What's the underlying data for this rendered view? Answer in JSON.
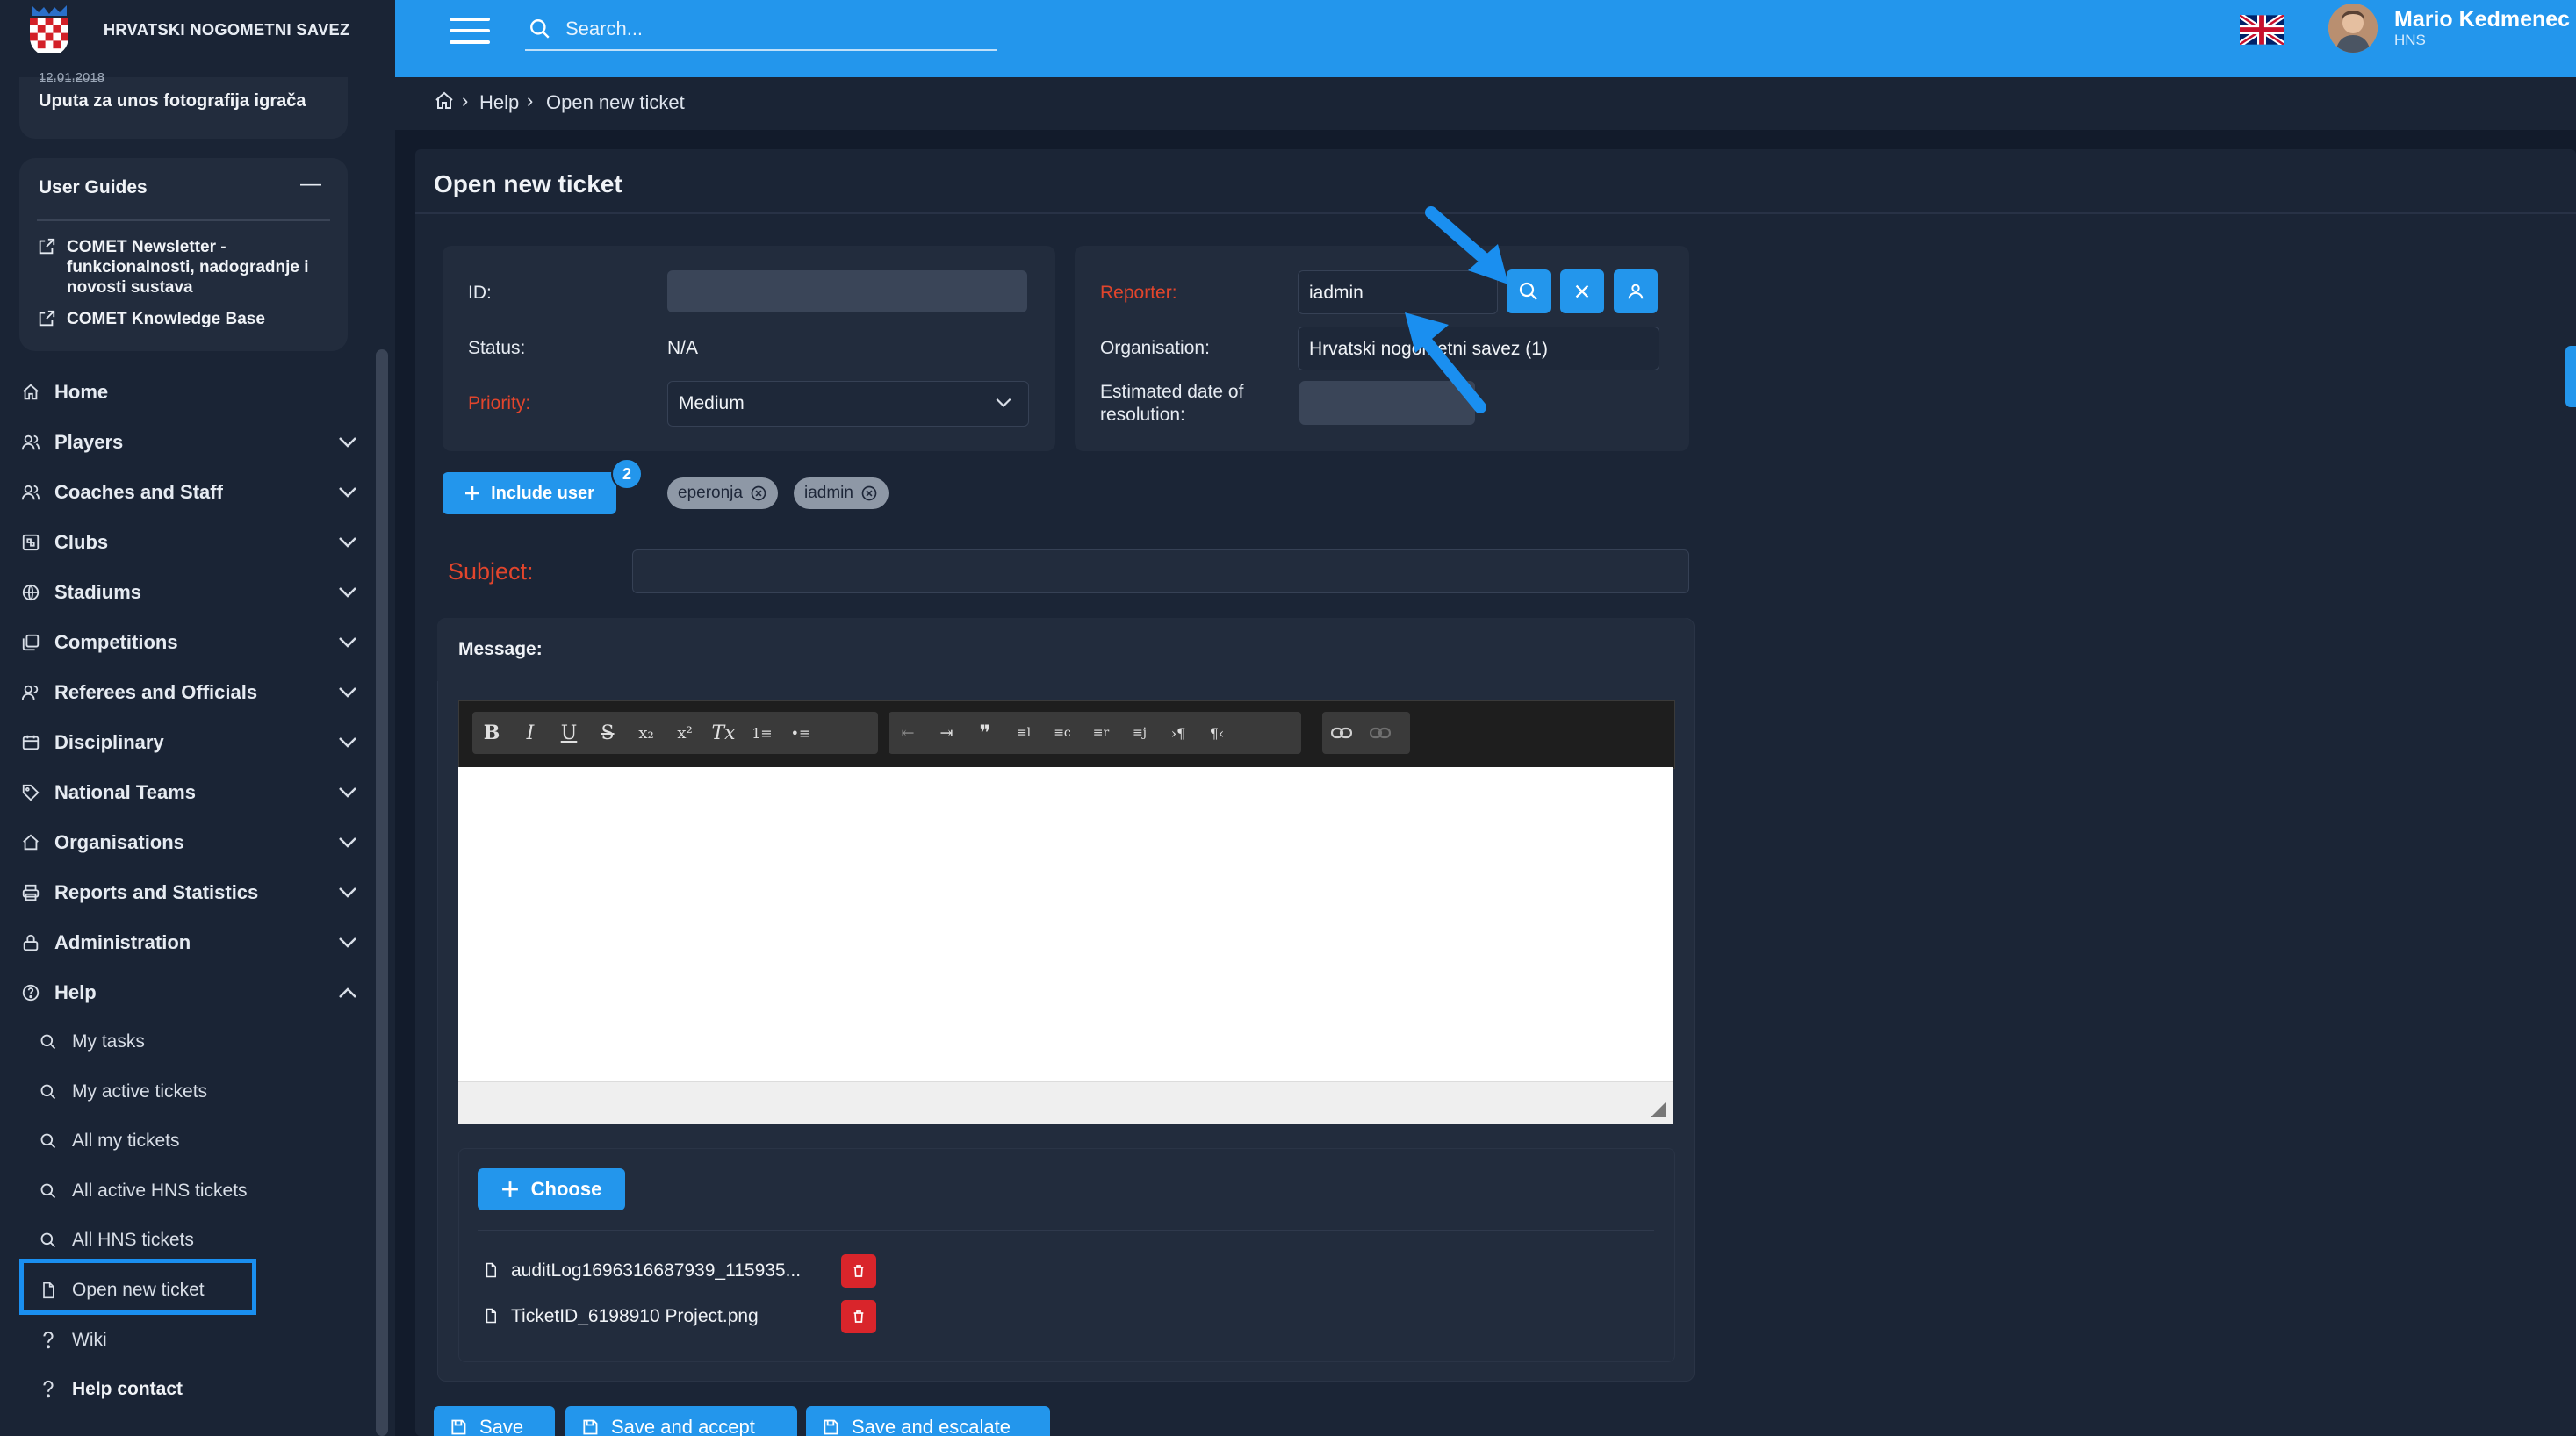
{
  "app": {
    "brand_name": "HRVATSKI NOGOMETNI SAVEZ"
  },
  "topbar": {
    "search_placeholder": "Search...",
    "user_name": "Mario Kedmenec",
    "user_org": "HNS",
    "language_flag": "uk-flag-icon"
  },
  "sidebar": {
    "news_card": {
      "date": "12.01.2018",
      "title": "Uputa za unos fotografija igrača"
    },
    "user_guides": {
      "title": "User Guides",
      "collapse_symbol": "—",
      "links": [
        {
          "label": "COMET Newsletter - funkcionalnosti, nadogradnje i novosti sustava",
          "icon": "external-link-icon"
        },
        {
          "label": "COMET Knowledge Base",
          "icon": "external-link-icon"
        }
      ]
    },
    "nav": [
      {
        "label": "Home",
        "icon": "home-icon"
      },
      {
        "label": "Players",
        "icon": "players-icon"
      },
      {
        "label": "Coaches and Staff",
        "icon": "coaches-icon"
      },
      {
        "label": "Clubs",
        "icon": "clubs-icon"
      },
      {
        "label": "Stadiums",
        "icon": "globe-icon"
      },
      {
        "label": "Competitions",
        "icon": "competitions-icon"
      },
      {
        "label": "Referees and Officials",
        "icon": "referees-icon"
      },
      {
        "label": "Disciplinary",
        "icon": "disciplinary-icon"
      },
      {
        "label": "National Teams",
        "icon": "tag-icon"
      },
      {
        "label": "Organisations",
        "icon": "organisations-icon"
      },
      {
        "label": "Reports and Statistics",
        "icon": "print-icon"
      },
      {
        "label": "Administration",
        "icon": "lock-icon"
      },
      {
        "label": "Help",
        "icon": "help-icon"
      }
    ],
    "help_sub": [
      {
        "label": "My tasks",
        "icon": "search-icon"
      },
      {
        "label": "My active tickets",
        "icon": "search-icon"
      },
      {
        "label": "All my tickets",
        "icon": "search-icon"
      },
      {
        "label": "All active HNS tickets",
        "icon": "search-icon"
      },
      {
        "label": "All HNS tickets",
        "icon": "search-icon"
      },
      {
        "label": "Open new ticket",
        "icon": "file-icon"
      },
      {
        "label": "Wiki",
        "icon": "question-icon"
      },
      {
        "label": "Help contact",
        "icon": "question-icon"
      }
    ]
  },
  "breadcrumb": {
    "items": [
      "Help",
      "Open new ticket"
    ]
  },
  "form": {
    "title": "Open new ticket",
    "left": {
      "id_label": "ID:",
      "id_value": "",
      "status_label": "Status:",
      "status_value": "N/A",
      "priority_label": "Priority:",
      "priority_value": "Medium"
    },
    "right": {
      "reporter_label": "Reporter:",
      "reporter_value": "iadmin",
      "organisation_label": "Organisation:",
      "organisation_value": "Hrvatski nogometni savez (1)",
      "est_label": "Estimated date of resolution:",
      "est_value": ""
    },
    "include_user_label": "Include user",
    "include_badge": "2",
    "included_users": [
      "eperonja",
      "iadmin"
    ],
    "subject_label": "Subject:",
    "subject_value": "",
    "message_label": "Message:",
    "editor_toolbar": {
      "groups": [
        [
          "B",
          "I",
          "U",
          "S",
          "x₂",
          "x²",
          "Tx",
          "1≡",
          "•≡"
        ],
        [
          "⇤",
          "⇥",
          "❞",
          "≡l",
          "≡c",
          "≡r",
          "≡j",
          "›¶",
          "¶‹"
        ],
        [
          "link",
          "unlink"
        ]
      ]
    },
    "choose_label": "Choose",
    "attachments": [
      "auditLog1696316687939_115935...",
      "TicketID_6198910 Project.png"
    ],
    "buttons": {
      "save": "Save",
      "save_accept": "Save and accept",
      "save_escalate": "Save and escalate"
    }
  },
  "colors": {
    "accent": "#2396ec",
    "background": "#121b2b",
    "sidebar": "#1a2435",
    "required_label": "#e2452c",
    "delete": "#d9252b",
    "highlight": "#1a8ff0"
  }
}
